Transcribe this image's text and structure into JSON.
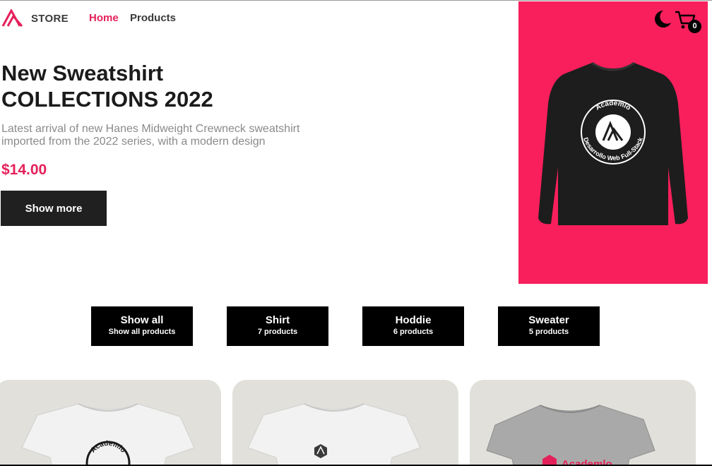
{
  "brand": {
    "name": "STORE",
    "accent_color": "#e4205a",
    "panel_color": "#f81f5c"
  },
  "nav": {
    "items": [
      {
        "label": "Home",
        "active": true
      },
      {
        "label": "Products",
        "active": false
      }
    ]
  },
  "header_icons": {
    "theme_toggle": "moon-icon",
    "cart": "cart-icon",
    "cart_count": "0"
  },
  "hero": {
    "title_line1": "New Sweatshirt",
    "title_line2": "COLLECTIONS 2022",
    "description_line1": "Latest arrival of new Hanes Midweight Crewneck sweatshirt",
    "description_line2": "imported from the 2022 series, with a modern design",
    "price": "$14.00",
    "button_label": "Show more",
    "image": {
      "icon": "sweatshirt-image",
      "print_line1": "Academlo",
      "print_line2": "Desarrollo Web Full-Stack"
    }
  },
  "filters": [
    {
      "name": "Show all",
      "count": "Show all products"
    },
    {
      "name": "Shirt",
      "count": "7 products"
    },
    {
      "name": "Hoddie",
      "count": "6 products"
    },
    {
      "name": "Sweater",
      "count": "5 products"
    }
  ],
  "products": [
    {
      "image": "white-tshirt-image",
      "print": "Academlo",
      "shirt_color": "#f2f2f2"
    },
    {
      "image": "white-tshirt-image",
      "print": "",
      "shirt_color": "#f2f2f2"
    },
    {
      "image": "gray-tshirt-image",
      "print": "Academlo",
      "shirt_color": "#a9a9a9"
    }
  ]
}
